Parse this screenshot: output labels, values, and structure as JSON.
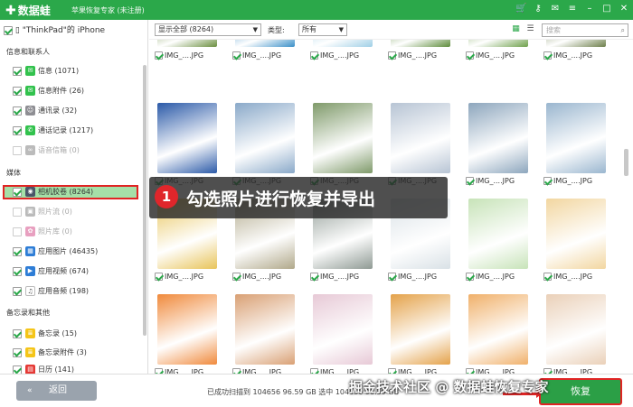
{
  "app": {
    "name": "数据蛙",
    "subtitle": "苹果恢复专家 (未注册)"
  },
  "sidebar": {
    "device": "\"ThinkPad\"的 iPhone",
    "sections": [
      {
        "title": "信息和联系人",
        "items": [
          {
            "label": "信息 (1071)",
            "checked": true,
            "icon_color": "#32c24d",
            "icon": "chat-icon"
          },
          {
            "label": "信息附件 (26)",
            "checked": true,
            "icon_color": "#32c24d",
            "icon": "attachment-icon"
          },
          {
            "label": "通讯录 (32)",
            "checked": true,
            "icon_color": "#8e8e93",
            "icon": "contacts-icon"
          },
          {
            "label": "通话记录 (1217)",
            "checked": true,
            "icon_color": "#32c24d",
            "icon": "phone-icon"
          },
          {
            "label": "语音信箱 (0)",
            "checked": false,
            "icon_color": "#bbbbbb",
            "icon": "voicemail-icon"
          }
        ]
      },
      {
        "title": "媒体",
        "items": [
          {
            "label": "相机胶卷 (8264)",
            "checked": true,
            "icon_color": "#4a5568",
            "icon": "camera-icon",
            "selected": true
          },
          {
            "label": "照片流 (0)",
            "checked": false,
            "icon_color": "#bbbbbb",
            "icon": "photostream-icon"
          },
          {
            "label": "照片库 (0)",
            "checked": false,
            "icon_color": "#e8a0c0",
            "icon": "photos-icon"
          },
          {
            "label": "应用图片 (46435)",
            "checked": true,
            "icon_color": "#2e7dd6",
            "icon": "app-photo-icon"
          },
          {
            "label": "应用视频 (674)",
            "checked": true,
            "icon_color": "#2e7dd6",
            "icon": "app-video-icon"
          },
          {
            "label": "应用音频 (198)",
            "checked": true,
            "icon_color": "#ffffff",
            "icon": "music-icon"
          }
        ]
      },
      {
        "title": "备忘录和其他",
        "items": [
          {
            "label": "备忘录 (15)",
            "checked": true,
            "icon_color": "#f5c518",
            "icon": "notes-icon"
          },
          {
            "label": "备忘录附件 (3)",
            "checked": true,
            "icon_color": "#f5c518",
            "icon": "notes-attachment-icon"
          },
          {
            "label": "日历 (141)",
            "checked": true,
            "icon_color": "#e53935",
            "icon": "calendar-icon"
          }
        ]
      }
    ]
  },
  "toolbar": {
    "filter_value": "显示全部 (8264)",
    "type_label": "类型:",
    "type_value": "所有",
    "search_placeholder": "搜索"
  },
  "grid": {
    "caption": "IMG_....JPG",
    "rows": [
      [
        "#6a8e3e",
        "#3a8fc8",
        "#9fcfe6",
        "#5d8c3a",
        "#6ea04a",
        "#6d7f4a"
      ],
      [
        "#2b5aa8",
        "#8aa9c9",
        "#7f9a6a",
        "#b7c4d4",
        "#8da6bd",
        "#9ab6cf"
      ],
      [
        "#e8c45a",
        "#b0a88a",
        "#8f9a94",
        "#d9e1e6",
        "#c7e3b8",
        "#f2d6a0"
      ],
      [
        "#f08a3c",
        "#d9a074",
        "#e7c9d6",
        "#e4a24a",
        "#f0b06a",
        "#ead0b8"
      ]
    ]
  },
  "annotation": {
    "number": "1",
    "text": "勾选照片进行恢复并导出"
  },
  "footer": {
    "back_label": "返回",
    "back_arrow": "«",
    "stats": "已成功扫描到 104656 96.59 GB  选中 104656 96.59 GB",
    "watermark": "掘金技术社区 @ 数据蛙恢复专家",
    "recover_label": "恢复"
  },
  "colors": {
    "brand": "#2ba84a",
    "highlight": "#e02424",
    "selected_bg": "#a5e0a8"
  }
}
